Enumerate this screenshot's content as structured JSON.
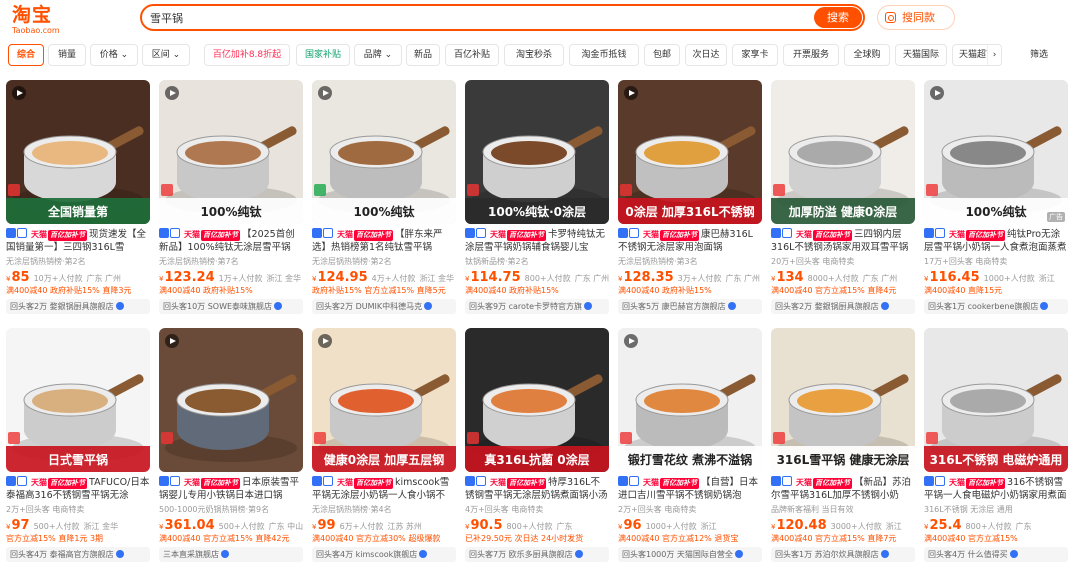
{
  "logo": {
    "cn": "淘宝",
    "en": "Taobao.com"
  },
  "search": {
    "query": "雪平锅",
    "button": "搜索",
    "photo": "搜同款"
  },
  "filters": [
    "综合",
    "销量",
    "价格",
    "区间",
    "百亿加补8.8折起",
    "国家补贴",
    "品牌",
    "新品",
    "百亿补贴",
    "淘宝秒杀",
    "淘金币抵钱",
    "包邮",
    "次日达",
    "家享卡",
    "开票服务",
    "全球购",
    "天猫国际",
    "天猫超市",
    "筛选"
  ],
  "colors": {
    "accent": "#ff5000",
    "tmall": "#ff0036",
    "blue": "#3270f5"
  },
  "products": [
    {
      "title": "现货速发【全国销量第一】三四钢316L雪",
      "sub": "无涂层锅热销榜·第2名",
      "price_prefix": "¥",
      "price": "85",
      "sales": "10万+人付款",
      "loc": "广东 广州",
      "promo": "满400减40  政府补贴15%  直降3元",
      "shop": "回头客2万  婺銀锅厨具旗舰店",
      "img": {
        "bg": "#4a2e22",
        "pan": "#d8d8d8",
        "food": "#e8b880",
        "label": "全国销量第",
        "label_bg": "#1d6e3a",
        "accent": "#e33"
      },
      "video": true,
      "ad": false
    },
    {
      "title": "【2025首创新品】100%纯钛无涂层雪平锅",
      "sub": "无涂层锅热销榜·第7名",
      "price_prefix": "¥",
      "price": "123.24",
      "sales": "1万+人付款",
      "loc": "浙江 金华",
      "promo": "满400减40  政府补贴15%",
      "shop": "回头客10万  SOWE泰味旗舰店",
      "img": {
        "bg": "#e8e3dc",
        "pan": "#c8c8c8",
        "food": "#b07850",
        "label": "100%纯钛",
        "label_bg": "#ffffff",
        "accent": "#e33"
      },
      "video": true,
      "ad": false
    },
    {
      "title": "【胖东来严选】热销榜第1名纯钛雪平锅",
      "sub": "无涂层锅热销榜·第2名",
      "price_prefix": "¥",
      "price": "124.95",
      "sales": "4万+人付款",
      "loc": "浙江 金华",
      "promo": "政府补贴15%  官方立减15%  直降5元",
      "shop": "回头客2万  DUMIK中科德马克",
      "img": {
        "bg": "#eae6e0",
        "pan": "#bdbdbd",
        "food": "#a06a40",
        "label": "100%纯钛",
        "label_bg": "#ffffff",
        "accent": "#1aa84a"
      },
      "video": true,
      "ad": false
    },
    {
      "title": "卡罗特纯钛无涂层雪平锅奶锅辅食锅婴儿宝",
      "sub": "钛锅新品榜·第2名",
      "price_prefix": "¥",
      "price": "114.75",
      "sales": "800+人付款",
      "loc": "广东 广州",
      "promo": "满400减40  政府补贴15%",
      "shop": "回头客9万  carote卡罗特官方旗",
      "img": {
        "bg": "#3a3a3a",
        "pan": "#cfcfcf",
        "food": "#7a4a2a",
        "label": "100%纯钛·0涂层",
        "label_bg": "#2a2a2a",
        "accent": "#e33"
      },
      "video": false,
      "ad": false
    },
    {
      "title": "康巴赫316L不锈钢无涂层家用泡面锅",
      "sub": "无涂层锅热销榜·第3名",
      "price_prefix": "¥",
      "price": "128.35",
      "sales": "3万+人付款",
      "loc": "广东 广州",
      "promo": "满400减40  政府补贴15%",
      "shop": "回头客5万  康巴赫官方旗舰店",
      "img": {
        "bg": "#5a3a2a",
        "pan": "#c0c0c0",
        "food": "#e0a040",
        "label": "0涂层 加厚316L不锈钢",
        "label_bg": "#c8141e",
        "accent": "#e33"
      },
      "video": true,
      "ad": false
    },
    {
      "title": "三四钢内层316L不锈钢汤锅家用双耳雪平锅",
      "sub": "20万+回头客 电商特卖",
      "price_prefix": "¥",
      "price": "134",
      "sales": "8000+人付款",
      "loc": "广东 广州",
      "promo": "满400减40  官方立减15%  直降4元",
      "shop": "回头客2万  婺銀锅厨具旗舰店",
      "img": {
        "bg": "#f0ede8",
        "pan": "#d0d0d0",
        "food": "#aaaaaa",
        "label": "加厚防溢 健康0涂层",
        "label_bg": "#2a5a3a",
        "accent": "#e33"
      },
      "video": false,
      "ad": false
    },
    {
      "title": "纯钛Pro无涂层雪平锅小奶锅一人食煮泡面蒸煮一体宝",
      "sub": "17万+回头客 电商特卖",
      "price_prefix": "¥",
      "price": "116.45",
      "sales": "1000+人付款",
      "loc": "浙江",
      "promo": "满400减40  直降15元",
      "shop": "回头客1万  cookerbene旗舰店",
      "img": {
        "bg": "#e8e8e8",
        "pan": "#bbbbbb",
        "food": "#888888",
        "label": "100%纯钛",
        "label_bg": "#ffffff",
        "accent": "#e33"
      },
      "video": true,
      "ad": true
    },
    {
      "title": "TAFUCO/日本泰福高316不锈钢雪平锅无涂",
      "sub": "2万+回头客 电商特卖",
      "price_prefix": "¥",
      "price": "97",
      "sales": "500+人付款",
      "loc": "浙江 金华",
      "promo": "官方立减15%  直降1元  3期",
      "shop": "回头客4万  泰福高官方旗舰店",
      "img": {
        "bg": "#f5f5f5",
        "pan": "#cccccc",
        "food": "#d8b080",
        "label": "日式雪平锅",
        "label_bg": "#c8141e",
        "accent": "#e33"
      },
      "video": false,
      "ad": false
    },
    {
      "title": "日本原装雪平锅婴儿专用小铁锅日本进口锅",
      "sub": "500-1000元奶锅热销榜·第9名",
      "price_prefix": "¥",
      "price": "361.04",
      "sales": "500+人付款",
      "loc": "广东 中山",
      "promo": "满400减40  官方立减15%  直降42元",
      "shop": "三本直采旗舰店",
      "img": {
        "bg": "#6a4a38",
        "pan": "#606a78",
        "food": "#8a5a30",
        "label": "",
        "label_bg": "#ffffff",
        "accent": "#e33"
      },
      "video": true,
      "ad": false
    },
    {
      "title": "kimscook雪平锅无涂层小奶锅一人食小锅不",
      "sub": "无涂层锅热销榜·第4名",
      "price_prefix": "¥",
      "price": "99",
      "sales": "6万+人付款",
      "loc": "江苏 苏州",
      "promo": "满400减40  官方立减30%  超级爆款",
      "shop": "回头客4万  kimscook旗舰店",
      "img": {
        "bg": "#f0e0c8",
        "pan": "#c8c8c8",
        "food": "#e06030",
        "label": "健康0涂层 加厚五层钢",
        "label_bg": "#c8141e",
        "accent": "#e33"
      },
      "video": true,
      "ad": false
    },
    {
      "title": "特厚316L不锈钢雪平锅无涂层奶锅煮面锅小汤",
      "sub": "4万+回头客 电商特卖",
      "price_prefix": "¥",
      "price": "90.5",
      "sales": "800+人付款",
      "loc": "广东",
      "promo": "已补29.50元  次日达  24小时发货",
      "shop": "回头客7万  欧乐多厨具旗舰店",
      "img": {
        "bg": "#2a2a2a",
        "pan": "#d0d0d0",
        "food": "#e08040",
        "label": "真316L抗菌 0涂层",
        "label_bg": "#c8141e",
        "accent": "#e33"
      },
      "video": false,
      "ad": false
    },
    {
      "title": "【自营】日本进口吉川雪平锅不锈钢奶锅泡",
      "sub": "2万+回头客 电商特卖",
      "price_prefix": "¥",
      "price": "96",
      "sales": "1000+人付款",
      "loc": "浙江",
      "promo": "满400减40  官方立减12%  退货宝",
      "shop": "回头客1000万  天猫国际自营全",
      "img": {
        "bg": "#f0f0f0",
        "pan": "#bbbbbb",
        "food": "#e08840",
        "label": "锻打雪花纹 煮沸不溢锅",
        "label_bg": "#ffffff",
        "accent": "#e33"
      },
      "video": true,
      "ad": false
    },
    {
      "title": "【新品】苏泊尔雪平锅316L加厚不锈钢小奶",
      "sub": "品牌新客福利 当日有效",
      "price_prefix": "¥",
      "price": "120.48",
      "sales": "3000+人付款",
      "loc": "浙江",
      "promo": "满400减40  官方立减15%  直降7元",
      "shop": "回头客1万  苏泊尔炊具旗舰店",
      "img": {
        "bg": "#e8e0d0",
        "pan": "#c4c4c4",
        "food": "#e8a040",
        "label": "316L雪平锅 健康无涂层",
        "label_bg": "#ffffff",
        "accent": "#e33"
      },
      "video": false,
      "ad": false
    },
    {
      "title": "316不锈钢雪平锅一人食电磁炉小奶锅家用煮面锅",
      "sub": "316L不锈钢  无涂层  通用",
      "price_prefix": "¥",
      "price": "25.4",
      "sales": "800+人付款",
      "loc": "广东",
      "promo": "满400减40  官方立减15%",
      "shop": "回头客4万  什么值得买",
      "img": {
        "bg": "#e8e8e8",
        "pan": "#cccccc",
        "food": "#aaaaaa",
        "label": "316L不锈钢 电磁炉通用",
        "label_bg": "#c8141e",
        "accent": "#e33"
      },
      "video": false,
      "ad": false
    }
  ]
}
